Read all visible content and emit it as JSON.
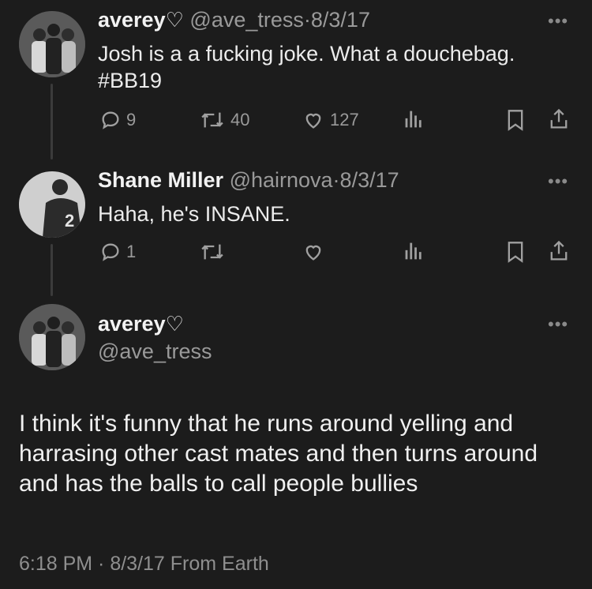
{
  "tweets": [
    {
      "display_name": "averey",
      "name_symbol": "♡",
      "handle": "@ave_tress",
      "separator": "·",
      "date": "8/3/17",
      "text_line1": "Josh is a a fucking joke. What a douchebag.",
      "text_line2": "#BB19",
      "replies": "9",
      "retweets": "40",
      "likes": "127"
    },
    {
      "display_name": "Shane Miller",
      "handle": "@hairnova",
      "separator": "·",
      "date": "8/3/17",
      "text": "Haha, he's INSANE.",
      "replies": "1"
    }
  ],
  "main_tweet": {
    "display_name": "averey",
    "name_symbol": "♡",
    "handle": "@ave_tress",
    "text": "I think it's funny that he runs around yelling and harrasing other cast mates and then turns around and has the balls to call people bullies",
    "footer": "6:18 PM · 8/3/17 From Earth"
  },
  "more_glyph": "•••",
  "colors": {
    "background": "#1c1c1c",
    "text": "#ececec",
    "muted": "#9a9a9a"
  }
}
